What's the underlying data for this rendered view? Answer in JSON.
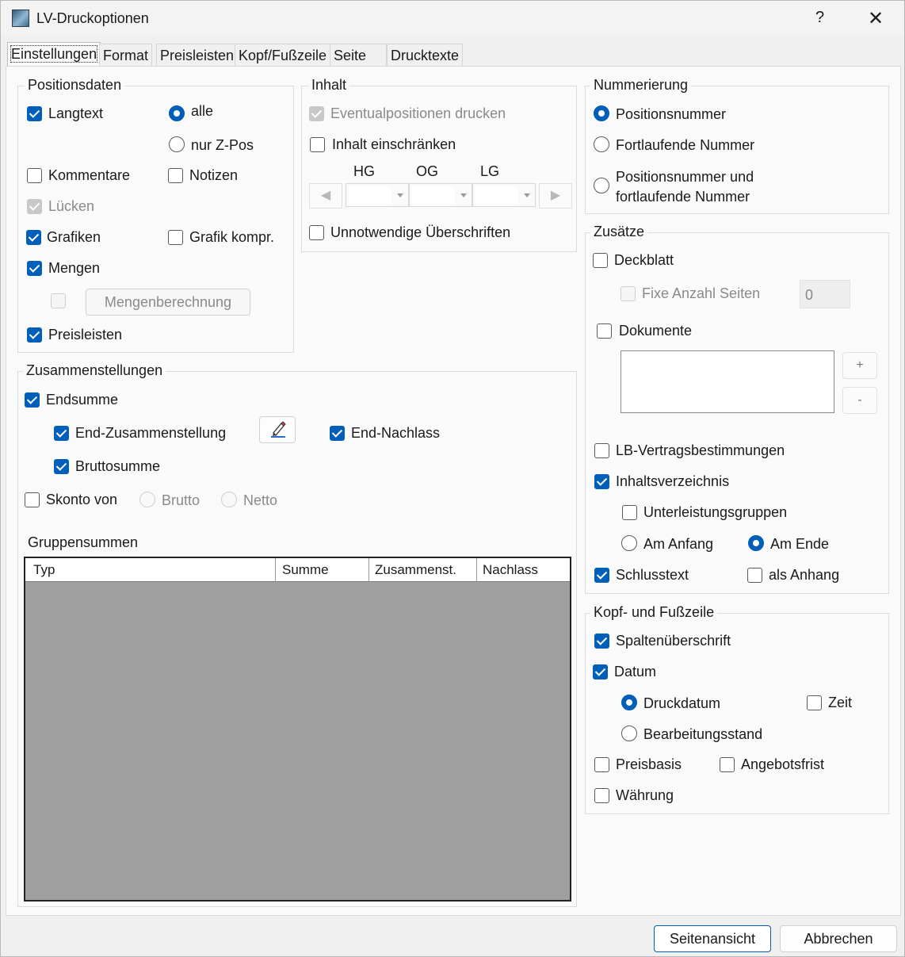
{
  "window": {
    "title": "LV-Druckoptionen",
    "help": "?",
    "close": "✕"
  },
  "tabs": [
    {
      "label": "Einstellungen",
      "active": true
    },
    {
      "label": "Format"
    },
    {
      "label": "Preisleisten"
    },
    {
      "label": "Kopf/Fußzeile"
    },
    {
      "label": "Seite"
    },
    {
      "label": "Drucktexte"
    }
  ],
  "positionsdaten": {
    "title": "Positionsdaten",
    "langtext": {
      "label": "Langtext",
      "checked": true
    },
    "alle": {
      "label": "alle",
      "checked": true
    },
    "nur_z_pos": {
      "label": "nur Z-Pos",
      "checked": false
    },
    "kommentare": {
      "label": "Kommentare",
      "checked": false
    },
    "notizen": {
      "label": "Notizen",
      "checked": false
    },
    "luecken": {
      "label": "Lücken",
      "checked": true,
      "disabled": true
    },
    "grafiken": {
      "label": "Grafiken",
      "checked": true
    },
    "grafik_kompr": {
      "label": "Grafik kompr.",
      "checked": false
    },
    "mengen": {
      "label": "Mengen",
      "checked": true
    },
    "mengenberechnung": {
      "label": "Mengenberechnung",
      "disabled": true
    },
    "preisleisten": {
      "label": "Preisleisten",
      "checked": true
    }
  },
  "inhalt": {
    "title": "Inhalt",
    "eventualpositionen": {
      "label": "Eventualpositionen drucken",
      "checked": true,
      "disabled": true
    },
    "inhalt_einschraenken": {
      "label": "Inhalt einschränken",
      "checked": false
    },
    "hg": "HG",
    "og": "OG",
    "lg": "LG",
    "unnotwendige": {
      "label": "Unnotwendige Überschriften",
      "checked": false
    }
  },
  "zusammenstellungen": {
    "title": "Zusammenstellungen",
    "endsumme": {
      "label": "Endsumme",
      "checked": true
    },
    "end_zusammenstellung": {
      "label": "End-Zusammenstellung",
      "checked": true
    },
    "end_nachlass": {
      "label": "End-Nachlass",
      "checked": true
    },
    "bruttosumme": {
      "label": "Bruttosumme",
      "checked": true
    },
    "skonto_von": {
      "label": "Skonto von",
      "checked": false
    },
    "brutto": {
      "label": "Brutto",
      "disabled": true
    },
    "netto": {
      "label": "Netto",
      "disabled": true
    },
    "gruppensummen": "Gruppensummen",
    "columns": [
      "Typ",
      "Summe",
      "Zusammenst.",
      "Nachlass"
    ]
  },
  "nummerierung": {
    "title": "Nummerierung",
    "positionsnummer": {
      "label": "Positionsnummer",
      "checked": true
    },
    "fortlaufende": {
      "label": "Fortlaufende Nummer",
      "checked": false
    },
    "beide_line1": "Positionsnummer und",
    "beide_line2": "fortlaufende Nummer"
  },
  "zusaetze": {
    "title": "Zusätze",
    "deckblatt": {
      "label": "Deckblatt",
      "checked": false
    },
    "fixe_anzahl": {
      "label": "Fixe Anzahl Seiten",
      "checked": false,
      "disabled": true
    },
    "fixe_anzahl_value": "0",
    "dokumente": {
      "label": "Dokumente",
      "checked": false
    },
    "add": "+",
    "remove": "-",
    "lb_vertrag": {
      "label": "LB-Vertragsbestimmungen",
      "checked": false
    },
    "inhaltsverzeichnis": {
      "label": "Inhaltsverzeichnis",
      "checked": true
    },
    "unterleistungsgruppen": {
      "label": "Unterleistungsgruppen",
      "checked": false
    },
    "am_anfang": {
      "label": "Am Anfang",
      "checked": false
    },
    "am_ende": {
      "label": "Am Ende",
      "checked": true
    },
    "schlusstext": {
      "label": "Schlusstext",
      "checked": true
    },
    "als_anhang": {
      "label": "als Anhang",
      "checked": false
    }
  },
  "kopf_fuss": {
    "title": "Kopf- und Fußzeile",
    "spaltenueberschrift": {
      "label": "Spaltenüberschrift",
      "checked": true
    },
    "datum": {
      "label": "Datum",
      "checked": true
    },
    "druckdatum": {
      "label": "Druckdatum",
      "checked": true
    },
    "zeit": {
      "label": "Zeit",
      "checked": false
    },
    "bearbeitungsstand": {
      "label": "Bearbeitungsstand",
      "checked": false
    },
    "preisbasis": {
      "label": "Preisbasis",
      "checked": false
    },
    "angebotsfrist": {
      "label": "Angebotsfrist",
      "checked": false
    },
    "waehrung": {
      "label": "Währung",
      "checked": false
    }
  },
  "footer": {
    "seitenansicht": "Seitenansicht",
    "abbrechen": "Abbrechen"
  }
}
